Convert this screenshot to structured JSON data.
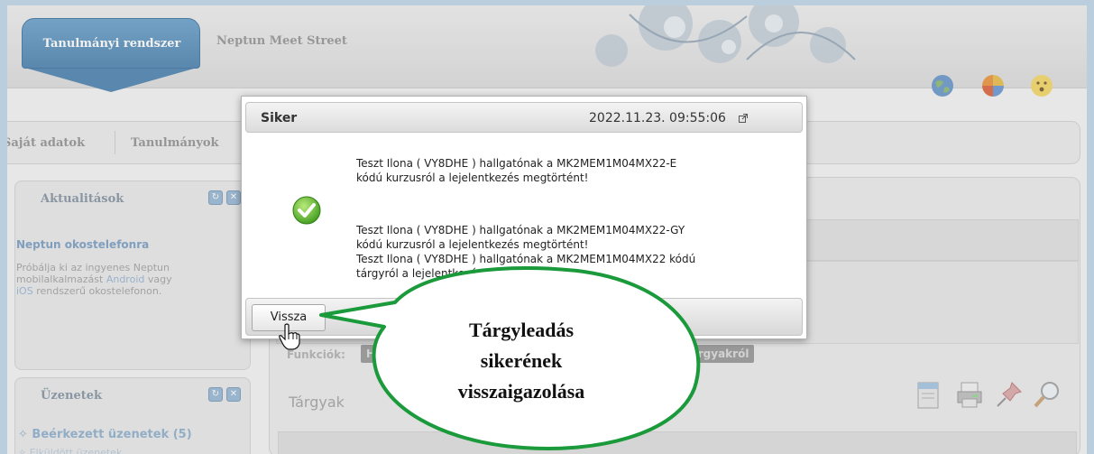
{
  "header": {
    "tab_active": "Tanulmányi rendszer",
    "tab_inactive": "Neptun Meet Street",
    "icons": [
      "globe-icon",
      "color-wheel-icon",
      "smiley-icon"
    ]
  },
  "menu": {
    "items": [
      "Saját adatok",
      "Tanulmányok"
    ]
  },
  "sidebar": {
    "news_title": "Aktualitások",
    "news_item_title": "Neptun okostelefonra",
    "news_text_1": "Próbálja ki az ingyenes Neptun",
    "news_text_2a": "mobilalkalmazást ",
    "news_link_android": "Android",
    "news_text_2b": " vagy",
    "news_link_ios": "iOS",
    "news_text_3": " rendszerű okostelefonon.",
    "messages_title": "Üzenetek",
    "inbox_label": "Beérkezett üzenetek (5)",
    "sent_label": "Elküldött üzenetek"
  },
  "main": {
    "functions_label": "Funkciók:",
    "func_add_favorite": "Hozzáadás a kedvencekhez",
    "func_declaration": "Nyilatkozat felvett tárgyakról",
    "subjects_title": "Tárgyak"
  },
  "modal": {
    "title": "Siker",
    "timestamp": "2022.11.23. 09:55:06",
    "messages": [
      "Teszt Ilona ( VY8DHE ) hallgatónak a MK2MEM1M04MX22-E",
      "kódú kurzusról a lejelentkezés megtörtént!",
      "Teszt Ilona ( VY8DHE ) hallgatónak a MK2MEM1M04MX22-GY",
      "kódú kurzusról a lejelentkezés megtörtént!",
      "Teszt Ilona ( VY8DHE ) hallgatónak a MK2MEM1M04MX22 kódú",
      "tárgyról a lejelentkezés megtörtént!"
    ],
    "back_button": "Vissza"
  },
  "callout": {
    "lines": [
      "Tárgyleadás",
      "sikerének",
      "visszaigazolása"
    ],
    "color": "#1a9a3a"
  }
}
